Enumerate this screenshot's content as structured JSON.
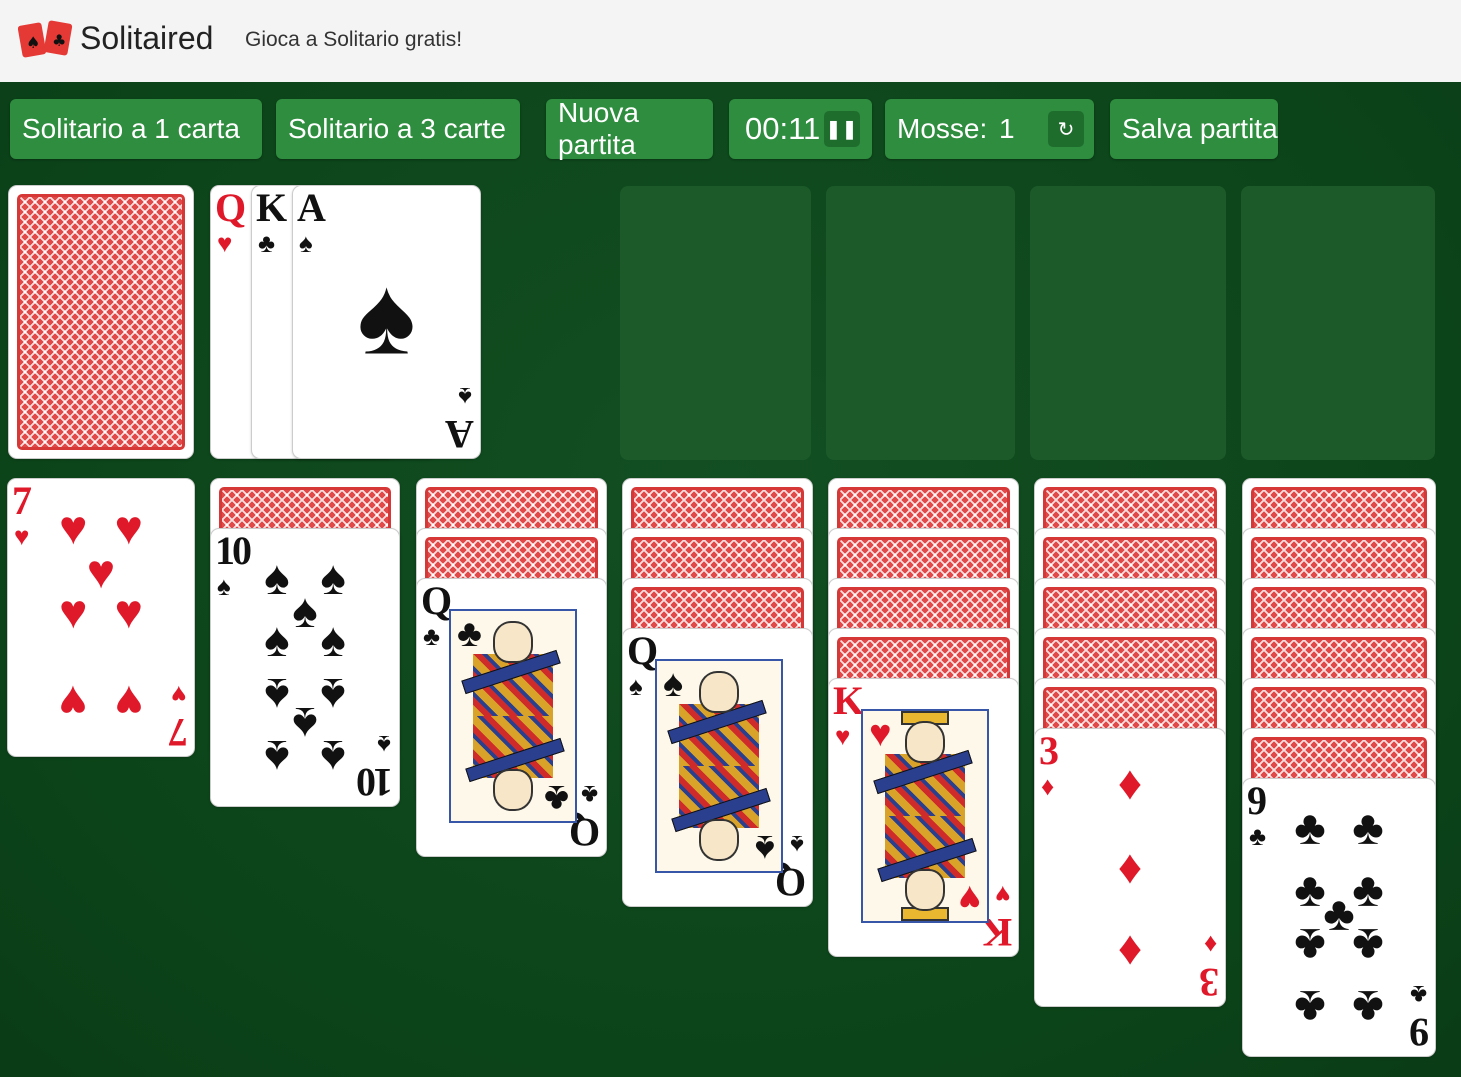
{
  "header": {
    "brand": "Solitaired",
    "tagline": "Gioca a Solitario gratis!"
  },
  "toolbar": {
    "one_card": "Solitario a 1 carta",
    "three_cards": "Solitario a 3 carte",
    "new_game": "Nuova partita",
    "timer": "00:11",
    "moves_label": "Mosse:",
    "moves_value": "1",
    "save_game": "Salva partita",
    "pause_icon": "pause-icon",
    "undo_icon": "undo-icon"
  },
  "colors": {
    "felt": "#0d4a1c",
    "button": "#2e8d3e",
    "slot": "#1c5a2a",
    "red_suit": "#e0192a"
  },
  "stock": {
    "face_down": true
  },
  "waste": [
    {
      "rank": "Q",
      "suit": "♥"
    },
    {
      "rank": "K",
      "suit": "♣"
    },
    {
      "rank": "A",
      "suit": "♠"
    }
  ],
  "foundations": [
    "",
    "",
    "",
    ""
  ],
  "tableau": [
    {
      "hidden": 0,
      "top": {
        "rank": "7",
        "suit": "♥"
      }
    },
    {
      "hidden": 1,
      "top": {
        "rank": "10",
        "suit": "♠"
      }
    },
    {
      "hidden": 2,
      "top": {
        "rank": "Q",
        "suit": "♣"
      }
    },
    {
      "hidden": 3,
      "top": {
        "rank": "Q",
        "suit": "♠"
      }
    },
    {
      "hidden": 4,
      "top": {
        "rank": "K",
        "suit": "♥"
      }
    },
    {
      "hidden": 5,
      "top": {
        "rank": "3",
        "suit": "♦"
      }
    },
    {
      "hidden": 6,
      "top": {
        "rank": "9",
        "suit": "♣"
      }
    }
  ]
}
